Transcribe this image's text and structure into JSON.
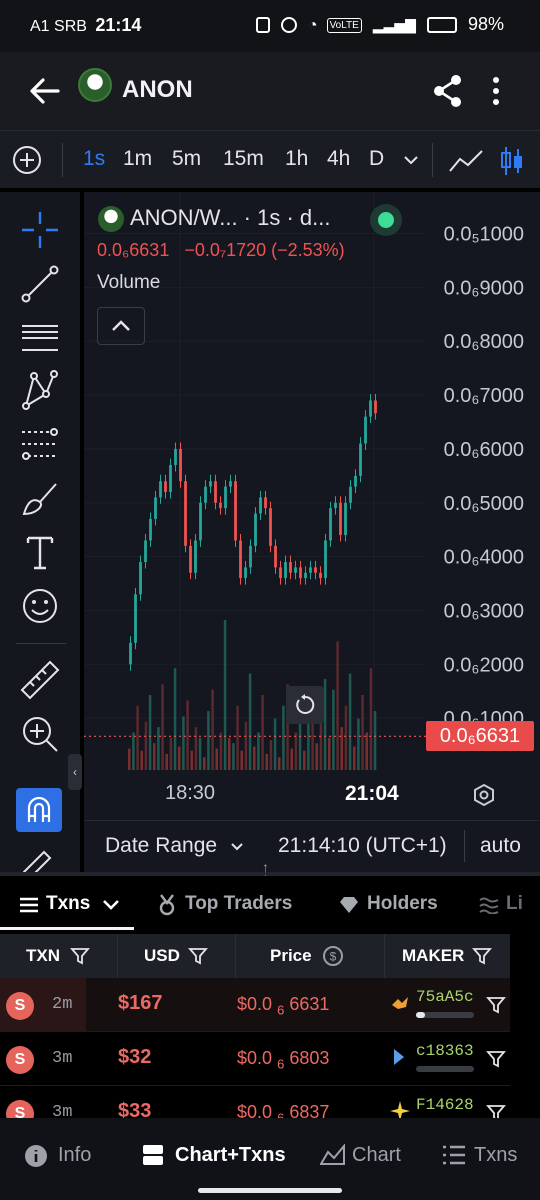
{
  "status_bar": {
    "carrier": "A1 SRB",
    "time": "21:14",
    "volte": "VoLTE",
    "battery": "98%"
  },
  "header": {
    "title": "ANON",
    "icons": [
      "back-arrow-icon",
      "token-avatar",
      "share-icon",
      "more-vertical-icon"
    ]
  },
  "intervals": {
    "items": [
      "1s",
      "1m",
      "5m",
      "15m",
      "1h",
      "4h",
      "D"
    ],
    "active": "1s",
    "icons": [
      "add-indicator-icon",
      "chevron-down-icon",
      "line-chart-icon",
      "candlestick-icon"
    ]
  },
  "toolbar": {
    "tools": [
      "crosshair-icon",
      "trend-line-icon",
      "horizontal-lines-icon",
      "pattern-icon",
      "fib-retracement-icon",
      "brush-icon",
      "text-icon",
      "emoji-icon",
      "ruler-icon",
      "zoom-in-icon",
      "magnet-icon",
      "pencil-lock-icon"
    ],
    "active_tool": "crosshair-icon",
    "highlighted_tool": "magnet-icon"
  },
  "chart_legend": {
    "symbol": "ANON/W... · 1s · d...",
    "last": "0.0₆6631",
    "change": "−0.0₇1720 (−2.53%)",
    "volume_label": "Volume",
    "status_dot_color": "#3ddc97"
  },
  "chart_data": {
    "type": "candlestick",
    "price_axis": {
      "ticks": [
        "0.0₅1000",
        "0.0₆9000",
        "0.0₆8000",
        "0.0₆7000",
        "0.0₆6000",
        "0.0₆5000",
        "0.0₆4000",
        "0.0₆3000",
        "0.0₆2000",
        "0.0₆1000"
      ],
      "last_price_label": "0.0₆6631",
      "last_price_value": 0.6631,
      "unit_note": "values in units of 0.0₆1 (1e-7)",
      "range": [
        0,
        10.4
      ]
    },
    "time_axis": {
      "ticks": [
        "18:30",
        "21:04"
      ],
      "bold_tick": "21:04"
    },
    "up_color": "#26a69a",
    "down_color": "#ef5350",
    "price_path": [
      2.0,
      2.4,
      3.3,
      3.9,
      4.3,
      4.7,
      5.1,
      5.4,
      5.2,
      5.7,
      6.0,
      5.4,
      4.2,
      3.7,
      4.3,
      5.0,
      5.3,
      5.4,
      5.0,
      4.9,
      5.3,
      5.4,
      4.3,
      3.6,
      3.8,
      4.2,
      4.8,
      5.1,
      4.9,
      4.2,
      3.8,
      3.6,
      3.9,
      3.7,
      3.8,
      3.6,
      3.7,
      3.8,
      3.7,
      3.6,
      4.3,
      4.9,
      5.0,
      4.4,
      5.0,
      5.3,
      5.5,
      6.1,
      6.6,
      6.9,
      6.6631
    ],
    "volume_range": [
      0,
      140
    ],
    "volumes": [
      20,
      35,
      60,
      18,
      45,
      70,
      25,
      40,
      80,
      15,
      30,
      95,
      22,
      50,
      65,
      18,
      40,
      30,
      12,
      55,
      75,
      20,
      35,
      140,
      30,
      25,
      60,
      18,
      45,
      90,
      22,
      35,
      70,
      15,
      28,
      48,
      12,
      60,
      80,
      20,
      35,
      50,
      18,
      45,
      65,
      25,
      55,
      85,
      30,
      75,
      120,
      40,
      60,
      90,
      22,
      48,
      70,
      35,
      95,
      55
    ]
  },
  "chart_footer": {
    "date_range": "Date Range",
    "time": "21:14:10 (UTC+1)",
    "scale": "auto"
  },
  "tabs": {
    "items": [
      "Txns",
      "Top Traders",
      "Holders",
      "Li"
    ],
    "active": "Txns"
  },
  "table": {
    "headers": [
      "TXN",
      "USD",
      "Price",
      "MAKER"
    ],
    "rows": [
      {
        "type": "S",
        "age": "2m",
        "usd": "$167",
        "price_pre": "$0.0",
        "price_sub": "6",
        "price_post": "6631",
        "maker": "75aA5c",
        "bar": 0.15
      },
      {
        "type": "S",
        "age": "3m",
        "usd": "$32",
        "price_pre": "$0.0",
        "price_sub": "6",
        "price_post": "6803",
        "maker": "c18363",
        "bar": 0.0
      },
      {
        "type": "S",
        "age": "3m",
        "usd": "$33",
        "price_pre": "$0.0",
        "price_sub": "6",
        "price_post": "6837",
        "maker": "F14628",
        "bar": 0.0
      }
    ]
  },
  "bottom_nav": {
    "items": [
      "Info",
      "Chart+Txns",
      "Chart",
      "Txns"
    ],
    "active": "Chart+Txns"
  }
}
